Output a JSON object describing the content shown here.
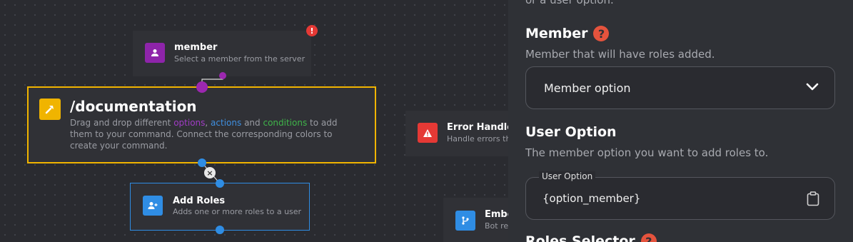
{
  "canvas": {
    "member_node": {
      "title": "member",
      "subtitle": "Select a member from the server",
      "icon": "user-icon",
      "color": "#8e24aa",
      "alert_icon": "exclamation-icon",
      "alert_symbol": "!"
    },
    "command_node": {
      "title": "/documentation",
      "icon": "hammer-icon",
      "color": "#f0b400",
      "desc_part1": "Drag and drop different ",
      "options_word": "options",
      "sep1": ", ",
      "actions_word": "actions",
      "sep2": " and ",
      "conditions_word": "conditions",
      "desc_part2": " to add them to your command. Connect the corresponding colors to create your command."
    },
    "error_node": {
      "title": "Error Handler",
      "subtitle": "Handle errors th",
      "icon": "warning-icon",
      "color": "#e53935"
    },
    "add_roles_node": {
      "title": "Add Roles",
      "subtitle": "Adds one or more roles to a user",
      "icon": "user-plus-icon",
      "color": "#2f8de4"
    },
    "embed_node": {
      "title": "Embe",
      "subtitle": "Bot re",
      "icon": "branch-icon",
      "color": "#2f8de4"
    },
    "connection_delete_symbol": "×"
  },
  "panel": {
    "top_partial_text": "or a user option.",
    "member": {
      "label": "Member",
      "help_symbol": "?",
      "description": "Member that will have roles added.",
      "select_value": "Member option",
      "chevron": "chevron-down-icon"
    },
    "user_option": {
      "label": "User Option",
      "description": "The member option you want to add roles to.",
      "field_label": "User Option",
      "field_value": "{option_member}",
      "clipboard_icon": "clipboard-icon"
    },
    "roles_selector": {
      "label": "Roles Selector",
      "help_symbol": "?"
    }
  },
  "colors": {
    "options": "#a13cc6",
    "actions": "#3f8fe0",
    "conditions": "#3fb54a",
    "help": "#e5533d"
  }
}
